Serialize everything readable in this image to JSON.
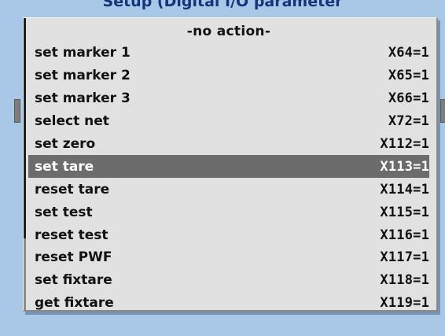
{
  "background": {
    "dialog_title": "Setup (Digital I/O parameter"
  },
  "menu": {
    "header": "-no action-",
    "items": [
      {
        "label": "set marker 1",
        "code": "X64=1"
      },
      {
        "label": "set marker 2",
        "code": "X65=1"
      },
      {
        "label": "set marker 3",
        "code": "X66=1"
      },
      {
        "label": "select net",
        "code": "X72=1"
      },
      {
        "label": "set zero",
        "code": "X112=1"
      },
      {
        "label": "set tare",
        "code": "X113=1",
        "selected": true
      },
      {
        "label": "reset tare",
        "code": "X114=1"
      },
      {
        "label": "set test",
        "code": "X115=1"
      },
      {
        "label": "reset test",
        "code": "X116=1"
      },
      {
        "label": "reset PWF",
        "code": "X117=1"
      },
      {
        "label": "set fixtare",
        "code": "X118=1"
      },
      {
        "label": "get fixtare",
        "code": "X119=1"
      }
    ]
  },
  "colors": {
    "window_background": "#a9c8e8",
    "menu_background": "#e1e1e1",
    "selection_background": "#6c6c6c",
    "selection_text": "#ffffff",
    "title_text": "#14357a"
  }
}
